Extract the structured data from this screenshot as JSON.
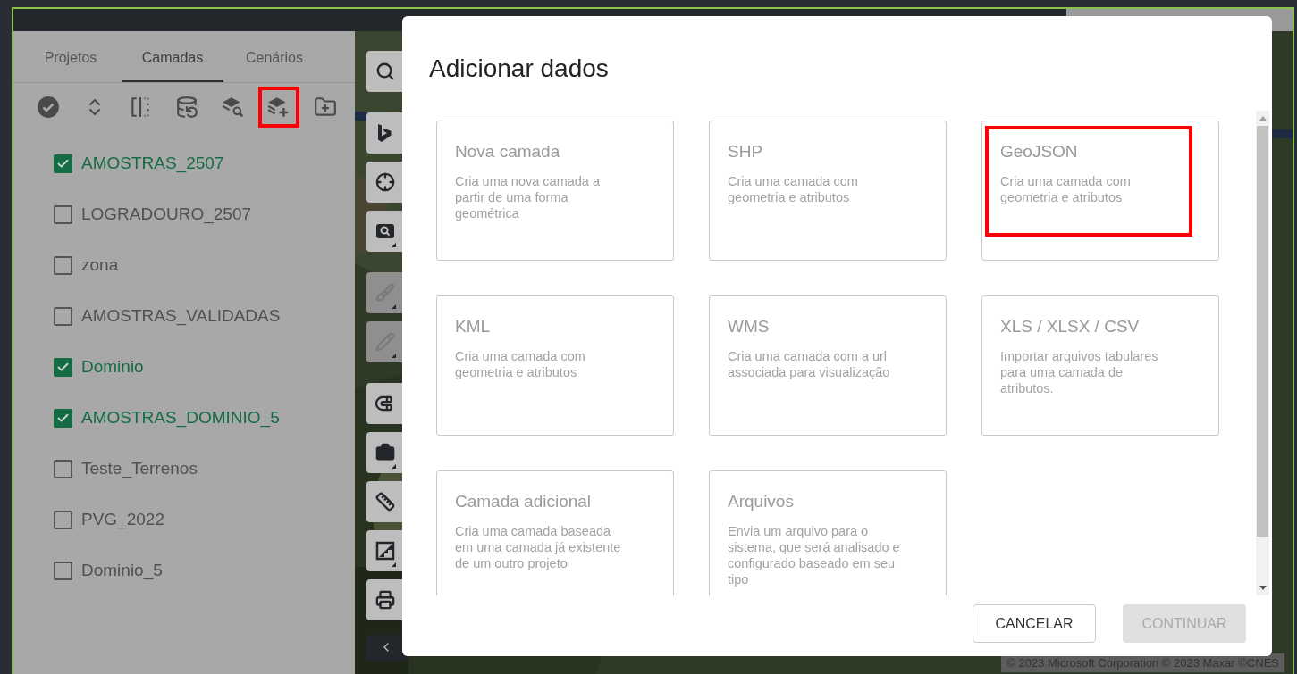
{
  "tabs": [
    {
      "label": "Projetos",
      "selected": false
    },
    {
      "label": "Camadas",
      "selected": true
    },
    {
      "label": "Cenários",
      "selected": false
    }
  ],
  "layer_tools": [
    {
      "kind": "check-all",
      "highlighted": false
    },
    {
      "kind": "expand",
      "highlighted": false
    },
    {
      "kind": "split",
      "highlighted": false
    },
    {
      "kind": "database",
      "highlighted": false
    },
    {
      "kind": "layer-search",
      "highlighted": false
    },
    {
      "kind": "layer-add",
      "highlighted": true
    },
    {
      "kind": "folder-add",
      "highlighted": false
    }
  ],
  "layers": [
    {
      "name": "AMOSTRAS_2507",
      "checked": true
    },
    {
      "name": "LOGRADOURO_2507",
      "checked": false
    },
    {
      "name": "zona",
      "checked": false
    },
    {
      "name": "AMOSTRAS_VALIDADAS",
      "checked": false
    },
    {
      "name": "Dominio",
      "checked": true
    },
    {
      "name": "AMOSTRAS_DOMINIO_5",
      "checked": true
    },
    {
      "name": "Teste_Terrenos",
      "checked": false
    },
    {
      "name": "PVG_2022",
      "checked": false
    },
    {
      "name": "Dominio_5",
      "checked": false
    }
  ],
  "map_tools": [
    {
      "kind": "search",
      "disabled": false,
      "has_menu": false
    },
    {
      "kind": "bing",
      "disabled": false,
      "has_menu": false
    },
    {
      "kind": "locate",
      "disabled": false,
      "has_menu": false
    },
    {
      "kind": "zoom-search",
      "disabled": false,
      "has_menu": true
    },
    {
      "kind": "brush",
      "disabled": true,
      "has_menu": true
    },
    {
      "kind": "pencil",
      "disabled": true,
      "has_menu": true
    },
    {
      "kind": "magnet",
      "disabled": false,
      "has_menu": false
    },
    {
      "kind": "briefcase",
      "disabled": false,
      "has_menu": true
    },
    {
      "kind": "ruler",
      "disabled": false,
      "has_menu": false
    },
    {
      "kind": "extent",
      "disabled": false,
      "has_menu": true
    },
    {
      "kind": "print",
      "disabled": false,
      "has_menu": false
    }
  ],
  "attribution": "© 2023 Microsoft Corporation © 2023 Maxar ©CNES",
  "dialog": {
    "title": "Adicionar dados",
    "options": [
      {
        "title": "Nova camada",
        "description": "Cria uma nova camada a partir de uma forma geométrica",
        "highlighted": false
      },
      {
        "title": "SHP",
        "description": "Cria uma camada com geometria e atributos",
        "highlighted": false
      },
      {
        "title": "GeoJSON",
        "description": "Cria uma camada com geometria e atributos",
        "highlighted": true
      },
      {
        "title": "KML",
        "description": "Cria uma camada com geometria e atributos",
        "highlighted": false
      },
      {
        "title": "WMS",
        "description": "Cria uma camada com a url associada para visualização",
        "highlighted": false
      },
      {
        "title": "XLS / XLSX / CSV",
        "description": "Importar arquivos tabulares para uma camada de atributos.",
        "highlighted": false
      },
      {
        "title": "Camada adicional",
        "description": "Cria uma camada baseada em uma camada já existente de um outro projeto",
        "highlighted": false
      },
      {
        "title": "Arquivos",
        "description": "Envia um arquivo para o sistema, que será analisado e configurado baseado em seu tipo",
        "highlighted": false
      }
    ],
    "buttons": [
      {
        "label": "CANCELAR",
        "disabled": false
      },
      {
        "label": "CONTINUAR",
        "disabled": true
      }
    ]
  }
}
